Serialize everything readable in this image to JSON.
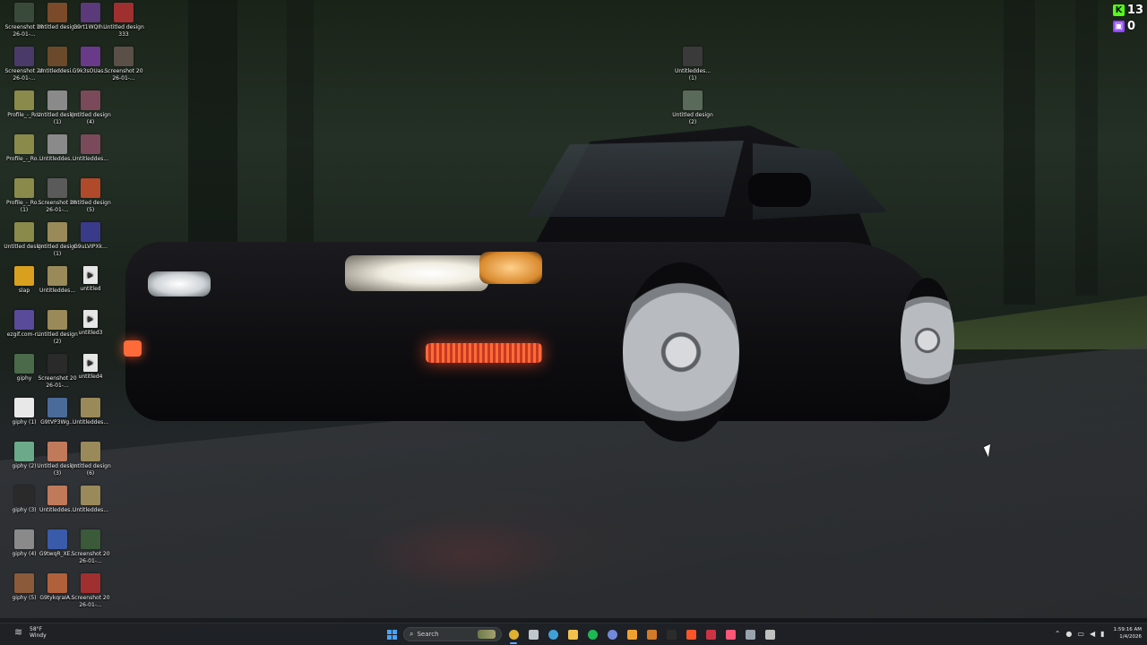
{
  "desktop": {
    "icons": [
      {
        "label": "Screenshot 2026-01-...",
        "thumb": "#3a4a3a",
        "icon": "screenshot-thumbnail"
      },
      {
        "label": "Untitled design",
        "thumb": "#7a4a2a",
        "icon": "image-thumbnail"
      },
      {
        "label": "G9rt1WQIh...",
        "thumb": "#5a3a7a",
        "icon": "image-thumbnail"
      },
      {
        "label": "Untitled design333",
        "thumb": "#a03030",
        "icon": "image-thumbnail"
      },
      {
        "label": "Screenshot 2026-01-...",
        "thumb": "#4a3a6a",
        "icon": "screenshot-thumbnail"
      },
      {
        "label": "Untitleddesi...",
        "thumb": "#6a4a2a",
        "icon": "image-thumbnail"
      },
      {
        "label": "G9k3sOUas...",
        "thumb": "#6a3a8a",
        "icon": "image-thumbnail"
      },
      {
        "label": "Screenshot 2026-01-...",
        "thumb": "#5a5048",
        "icon": "screenshot-thumbnail"
      },
      {
        "label": "Profile_-_Roz",
        "thumb": "#8a8a4a",
        "icon": "image-thumbnail"
      },
      {
        "label": "Untitled design (1)",
        "thumb": "#8a8a8a",
        "icon": "image-thumbnail"
      },
      {
        "label": "Untitled design (4)",
        "thumb": "#7a4a5a",
        "icon": "image-thumbnail"
      },
      {
        "label": "Profile_-_Ro...",
        "thumb": "#8a8a4a",
        "icon": "image-thumbnail"
      },
      {
        "label": "Untitleddes...",
        "thumb": "#8a8a8a",
        "icon": "image-thumbnail"
      },
      {
        "label": "Untitleddes...",
        "thumb": "#7a4a5a",
        "icon": "image-thumbnail"
      },
      {
        "label": "Profile_-_Ro... (1)",
        "thumb": "#8a8a4a",
        "icon": "image-thumbnail"
      },
      {
        "label": "Screenshot 2026-01-...",
        "thumb": "#5a5a5a",
        "icon": "screenshot-thumbnail"
      },
      {
        "label": "Untitled design (5)",
        "thumb": "#b04a2a",
        "icon": "image-thumbnail"
      },
      {
        "label": "Untitled design",
        "thumb": "#8a8a4a",
        "icon": "image-thumbnail"
      },
      {
        "label": "Untitled design (1)",
        "thumb": "#9a8a5a",
        "icon": "image-thumbnail"
      },
      {
        "label": "G9uLVIPXk...",
        "thumb": "#3a3a8a",
        "icon": "image-thumbnail"
      },
      {
        "label": "slap",
        "thumb": "#d9a020",
        "icon": "image-thumbnail"
      },
      {
        "label": "Untitleddes...",
        "thumb": "#9a8a5a",
        "icon": "image-thumbnail"
      },
      {
        "label": "untitled",
        "thumb": "#e6e6e6",
        "icon": "media-file-icon"
      },
      {
        "label": "ezgif.com-r...",
        "thumb": "#5a4a9a",
        "icon": "image-thumbnail"
      },
      {
        "label": "Untitled design (2)",
        "thumb": "#9a8a5a",
        "icon": "image-thumbnail"
      },
      {
        "label": "untitled3",
        "thumb": "#e6e6e6",
        "icon": "media-file-icon"
      },
      {
        "label": "giphy",
        "thumb": "#4a6a4a",
        "icon": "image-thumbnail"
      },
      {
        "label": "Screenshot 2026-01-...",
        "thumb": "#2a2a2a",
        "icon": "screenshot-thumbnail"
      },
      {
        "label": "untitled4",
        "thumb": "#e6e6e6",
        "icon": "media-file-icon"
      },
      {
        "label": "giphy (1)",
        "thumb": "#e8e8e8",
        "icon": "image-thumbnail"
      },
      {
        "label": "G9tVP3Wg...",
        "thumb": "#4a6a9a",
        "icon": "image-thumbnail"
      },
      {
        "label": "Untitleddes...",
        "thumb": "#9a8a5a",
        "icon": "image-thumbnail"
      },
      {
        "label": "giphy (2)",
        "thumb": "#6aaa8a",
        "icon": "image-thumbnail"
      },
      {
        "label": "Untitled design (3)",
        "thumb": "#c07a5a",
        "icon": "image-thumbnail"
      },
      {
        "label": "Untitled design (6)",
        "thumb": "#9a8a5a",
        "icon": "image-thumbnail"
      },
      {
        "label": "giphy (3)",
        "thumb": "#2a2a2a",
        "icon": "image-thumbnail"
      },
      {
        "label": "Untitleddes...",
        "thumb": "#c07a5a",
        "icon": "image-thumbnail"
      },
      {
        "label": "Untitleddes...",
        "thumb": "#9a8a5a",
        "icon": "image-thumbnail"
      },
      {
        "label": "giphy (4)",
        "thumb": "#8a8a8a",
        "icon": "image-thumbnail"
      },
      {
        "label": "G9twqR_XE...",
        "thumb": "#3a5aaa",
        "icon": "image-thumbnail"
      },
      {
        "label": "Screenshot 2026-01-...",
        "thumb": "#3a5a3a",
        "icon": "screenshot-thumbnail"
      },
      {
        "label": "giphy (5)",
        "thumb": "#8a5a3a",
        "icon": "image-thumbnail"
      },
      {
        "label": "G9tykqraIA...",
        "thumb": "#b0603a",
        "icon": "image-thumbnail"
      },
      {
        "label": "Screenshot 2026-01-...",
        "thumb": "#a03030",
        "icon": "screenshot-thumbnail"
      },
      {
        "label": "Untitleddes... (1)",
        "thumb": "#3a3a3a",
        "icon": "image-thumbnail"
      },
      {
        "label": "Untitled design (2)",
        "thumb": "#5a6a5a",
        "icon": "image-thumbnail"
      }
    ]
  },
  "overlay": {
    "kick_count": "13",
    "twitch_count": "0",
    "kick_color": "#53fc18",
    "twitch_color": "#9146ff"
  },
  "taskbar": {
    "weather_temp": "58°F",
    "weather_desc": "Windy",
    "search_placeholder": "Search",
    "clock_time": "1:59:16 AM",
    "clock_date": "1/4/2026",
    "apps": [
      {
        "name": "start-icon",
        "color": "#4aa3ff"
      },
      {
        "name": "chrome-icon",
        "color": "#e0b030",
        "active": true
      },
      {
        "name": "task-view-icon",
        "color": "#bfc6cc"
      },
      {
        "name": "edge-icon",
        "color": "#3fa0d8"
      },
      {
        "name": "file-explorer-icon",
        "color": "#f2c14e"
      },
      {
        "name": "spotify-icon",
        "color": "#1db954"
      },
      {
        "name": "discord-icon",
        "color": "#7289da"
      },
      {
        "name": "app-icon",
        "color": "#f0a030"
      },
      {
        "name": "app-icon",
        "color": "#d07a2a"
      },
      {
        "name": "terminal-icon",
        "color": "#2b2b2b"
      },
      {
        "name": "brave-icon",
        "color": "#fb542b"
      },
      {
        "name": "app-icon",
        "color": "#cc3344"
      },
      {
        "name": "app-icon",
        "color": "#ff5577"
      },
      {
        "name": "settings-icon",
        "color": "#9aa3ad"
      },
      {
        "name": "app-icon",
        "color": "#c0c0c0"
      }
    ]
  }
}
